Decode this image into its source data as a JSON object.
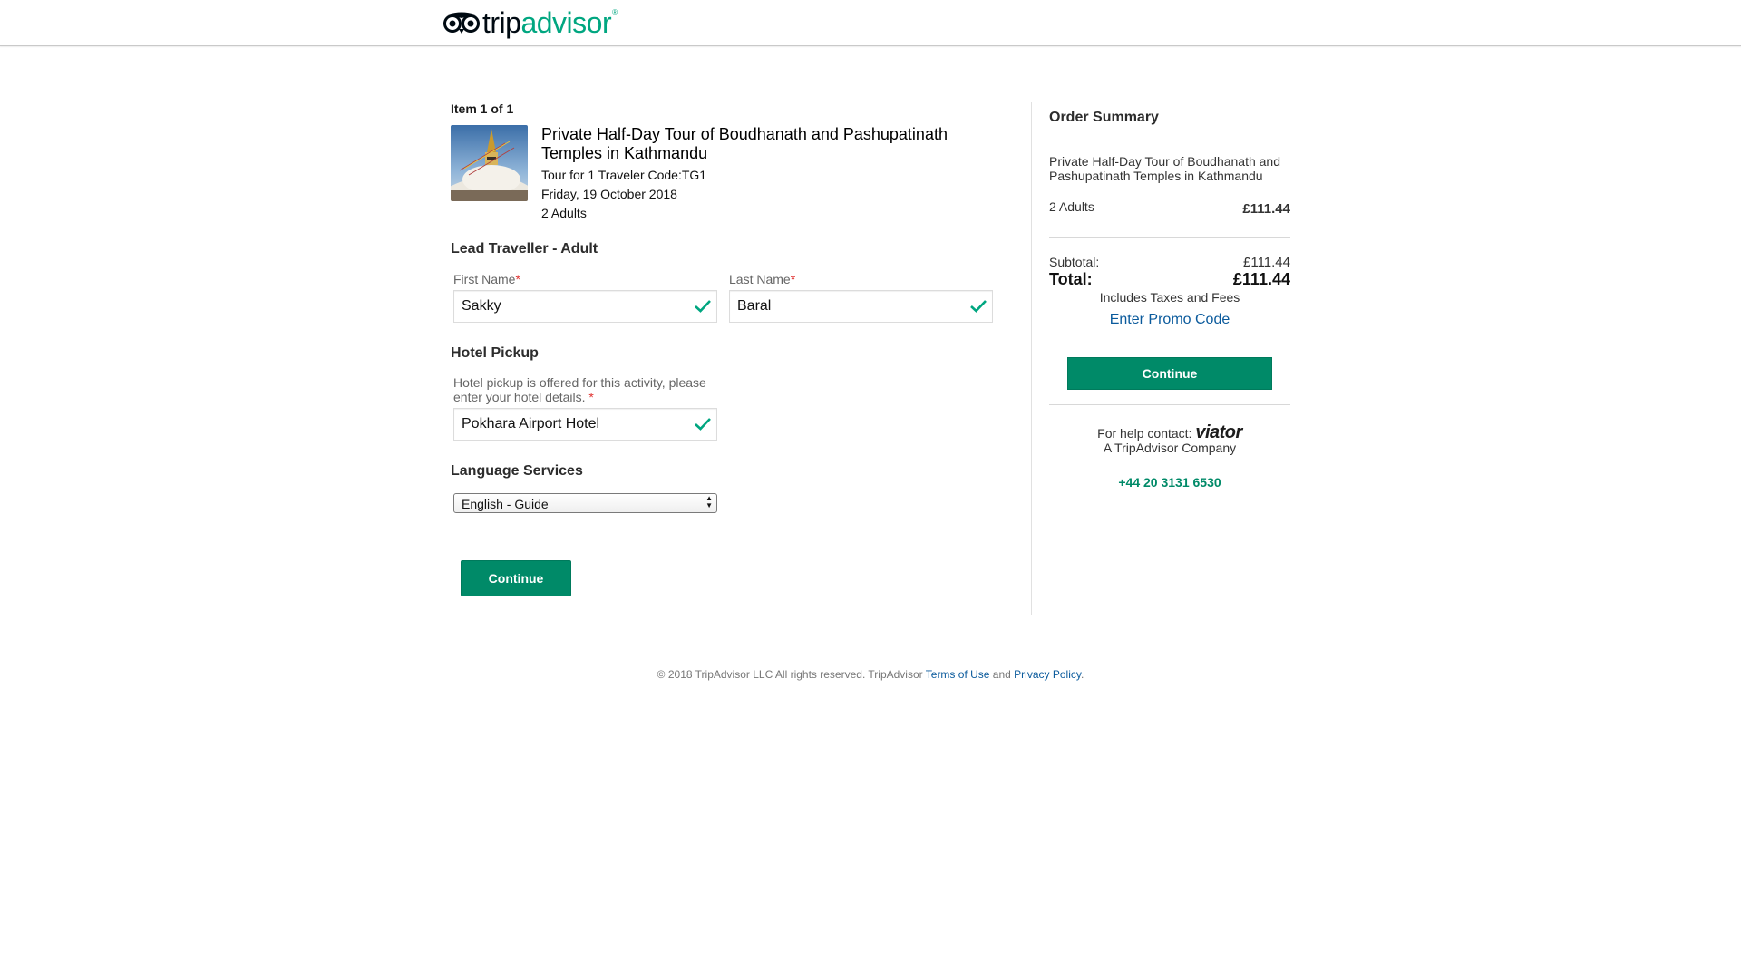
{
  "header": {
    "logo_part1": "trip",
    "logo_part2": "advisor",
    "logo_reg": "®"
  },
  "item": {
    "count": "Item 1 of 1",
    "title": "Private Half-Day Tour of Boudhanath and Pashupatinath Temples in Kathmandu",
    "details": "Tour for 1 Traveler Code:TG1",
    "date": "Friday, 19 October 2018",
    "travelers": "2 Adults"
  },
  "lead_traveller": {
    "section_title": "Lead Traveller - Adult",
    "first_name_label": "First Name",
    "first_name_value": "Sakky",
    "last_name_label": "Last Name",
    "last_name_value": "Baral",
    "required_mark": "*"
  },
  "hotel_pickup": {
    "section_title": "Hotel Pickup",
    "help_text": "Hotel pickup is offered for this activity, please enter your hotel details.",
    "required_mark": "*",
    "value": "Pokhara Airport Hotel"
  },
  "language": {
    "section_title": "Language Services",
    "selected": "English - Guide"
  },
  "main_continue_label": "Continue",
  "summary": {
    "title": "Order Summary",
    "product": "Private Half-Day Tour of Boudhanath and Pashupatinath Temples in Kathmandu",
    "adults_label": "2 Adults",
    "adults_price": "£111.44",
    "subtotal_label": "Subtotal:",
    "subtotal_value": "£111.44",
    "total_label": "Total:",
    "total_value": "£111.44",
    "taxes_note": "Includes Taxes and Fees",
    "promo_link": "Enter Promo Code",
    "continue_label": "Continue",
    "help_prefix": "For help contact:",
    "help_brand": "viator",
    "company": "A TripAdvisor Company",
    "phone": "+44 20 3131 6530"
  },
  "footer": {
    "copyright": "© 2018 TripAdvisor LLC All rights reserved. TripAdvisor",
    "terms": "Terms of Use",
    "and": "and",
    "privacy": "Privacy Policy",
    "period": "."
  },
  "colors": {
    "brand_green": "#00a680",
    "button_green": "#008a68",
    "link_blue": "#0a5a9c",
    "phone_green": "#008a68"
  },
  "icons": {
    "check": "check-icon",
    "owl_logo": "tripadvisor-owl-icon",
    "select_arrows": "select-arrows-icon"
  }
}
